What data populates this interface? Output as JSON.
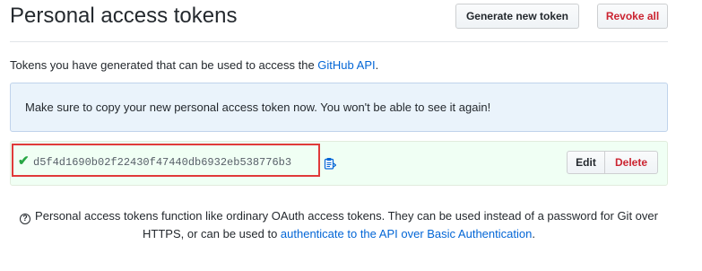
{
  "header": {
    "title": "Personal access tokens",
    "generate_label": "Generate new token",
    "revoke_label": "Revoke all"
  },
  "intro": {
    "text": "Tokens you have generated that can be used to access the ",
    "link": "GitHub API",
    "suffix": "."
  },
  "flash": {
    "message": "Make sure to copy your new personal access token now. You won't be able to see it again!"
  },
  "token": {
    "value": "d5f4d1690b02f22430f47440db6932eb538776b3",
    "edit_label": "Edit",
    "delete_label": "Delete"
  },
  "note": {
    "text": "Personal access tokens function like ordinary OAuth access tokens. They can be used instead of a password for Git over HTTPS, or can be used to ",
    "link": "authenticate to the API over Basic Authentication",
    "suffix": "."
  },
  "icons": {
    "check": "check-icon",
    "clipboard": "clipboard-icon",
    "question": "question-icon"
  },
  "colors": {
    "link": "#0366d6",
    "danger": "#cb2431",
    "success": "#28a745",
    "flash_bg": "#eaf3fb",
    "token_bg": "#f0fff4",
    "highlight": "#e03a3a"
  }
}
